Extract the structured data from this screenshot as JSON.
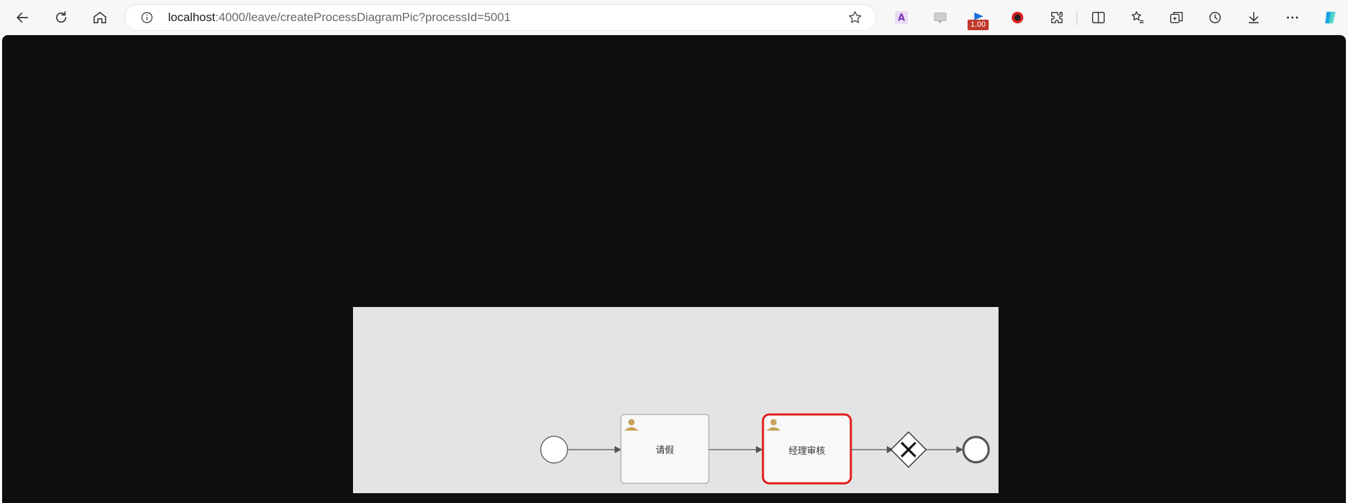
{
  "browser": {
    "url_host": "localhost",
    "url_path": ":4000/leave/createProcessDiagramPic?processId=5001",
    "extension_badge": "1.00"
  },
  "diagram": {
    "tasks": [
      {
        "label": "请假"
      },
      {
        "label": "经理审核"
      }
    ],
    "colors": {
      "active_task_border": "#e31b1b",
      "task_border": "#b5b5b5",
      "task_fill": "#f8f8f8",
      "canvas": "#e4e4e4",
      "flow": "#555555",
      "user_icon": "#c9a25a"
    },
    "elements": [
      "start-event",
      "task",
      "active-task",
      "exclusive-gateway",
      "end-event"
    ]
  }
}
